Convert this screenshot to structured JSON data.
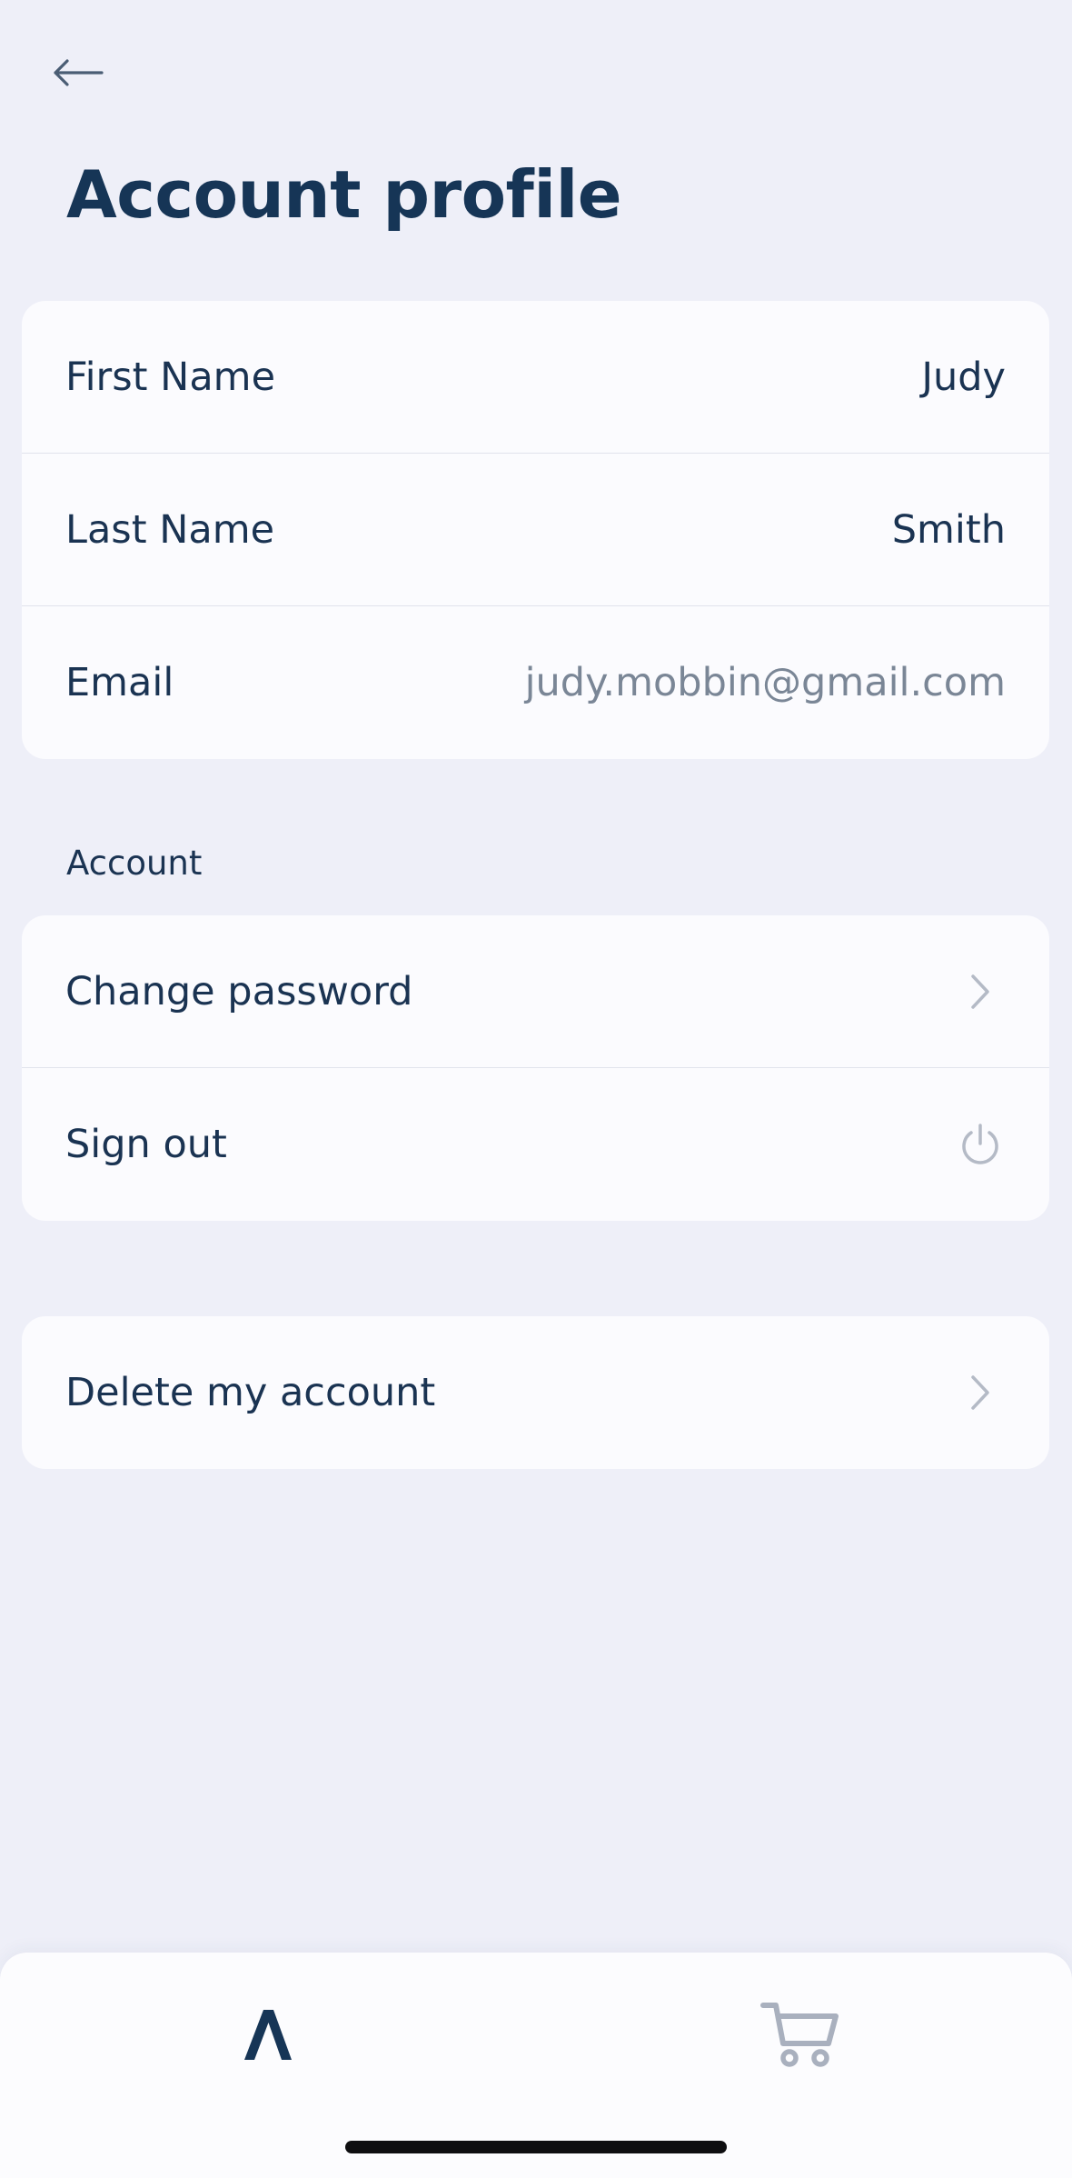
{
  "header": {
    "back_icon": "arrow-left-icon",
    "title": "Account profile"
  },
  "profile": {
    "fields": [
      {
        "label": "First Name",
        "value": "Judy"
      },
      {
        "label": "Last Name",
        "value": "Smith"
      },
      {
        "label": "Email",
        "value": "judy.mobbin@gmail.com"
      }
    ]
  },
  "account_section": {
    "heading": "Account",
    "items": [
      {
        "label": "Change password",
        "icon": "chevron-right-icon"
      },
      {
        "label": "Sign out",
        "icon": "power-icon"
      }
    ]
  },
  "danger_section": {
    "items": [
      {
        "label": "Delete my account",
        "icon": "chevron-right-icon"
      }
    ]
  },
  "tabbar": {
    "tabs": [
      {
        "icon": "lambda-logo-icon",
        "active": true
      },
      {
        "icon": "cart-icon",
        "active": false
      }
    ]
  },
  "colors": {
    "background": "#EEEFF8",
    "card": "#FBFBFE",
    "text_primary": "#1A3352",
    "text_muted": "#7A8696",
    "icon_muted": "#B4BAC6"
  }
}
